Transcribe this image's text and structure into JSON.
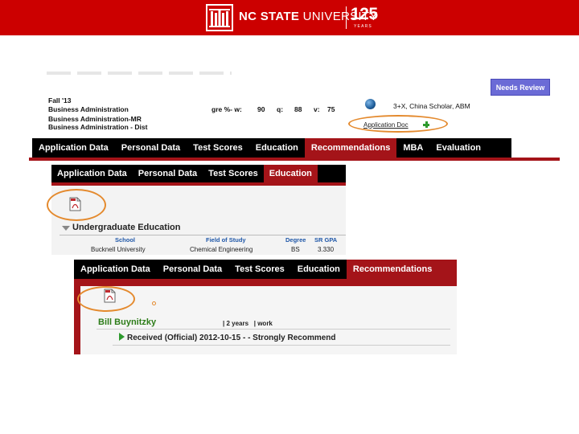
{
  "header": {
    "brand_bold": "NC STATE",
    "brand_light": "UNIVERSITY",
    "anniversary": "125",
    "anniversary_sub": "YEARS",
    "bg_color": "#cc0000"
  },
  "applicant": {
    "term": "Fall '13",
    "programs": [
      "Business Administration",
      "Business Administration-MR",
      "Business Administration - Dist"
    ],
    "gre_label": "gre %- w:",
    "gre_w": "90",
    "gre_q_label": "q:",
    "gre_q": "88",
    "gre_v_label": "v:",
    "gre_v": "75",
    "tags": "3+X, China Scholar, ABM",
    "app_doc_link": "Application Doc",
    "needs_review": "Needs Review"
  },
  "tabs_full": [
    "Application Data",
    "Personal Data",
    "Test Scores",
    "Education",
    "Recommendations",
    "MBA",
    "Evaluation"
  ],
  "tabs_full_active": "Recommendations",
  "education_panel": {
    "tabs": [
      "Application Data",
      "Personal Data",
      "Test Scores",
      "Education"
    ],
    "active": "Education",
    "heading": "Undergraduate Education",
    "columns": [
      "School",
      "Field of Study",
      "Degree",
      "SR GPA"
    ],
    "rows": [
      [
        "Bucknell University",
        "Chemical Engineering",
        "BS",
        "3.330"
      ]
    ]
  },
  "rec_panel": {
    "tabs": [
      "Application Data",
      "Personal Data",
      "Test Scores",
      "Education",
      "Recommendations"
    ],
    "active": "Recommendations",
    "recommender": "Bill Buynitzky",
    "duration": "2 years",
    "relation": "work",
    "status": "Received (Official) 2012-10-15 - - Strongly Recommend"
  },
  "icons": {
    "pdf": "pdf-file-icon",
    "globe": "globe-icon",
    "plus": "plus-icon",
    "triangle_down": "triangle-down-icon",
    "triangle_right": "triangle-right-icon"
  },
  "colors": {
    "accent_red": "#a41419",
    "highlight_orange": "#e48a2e",
    "review_button": "#6b6bd6",
    "recommender_green": "#2e7d1a"
  }
}
